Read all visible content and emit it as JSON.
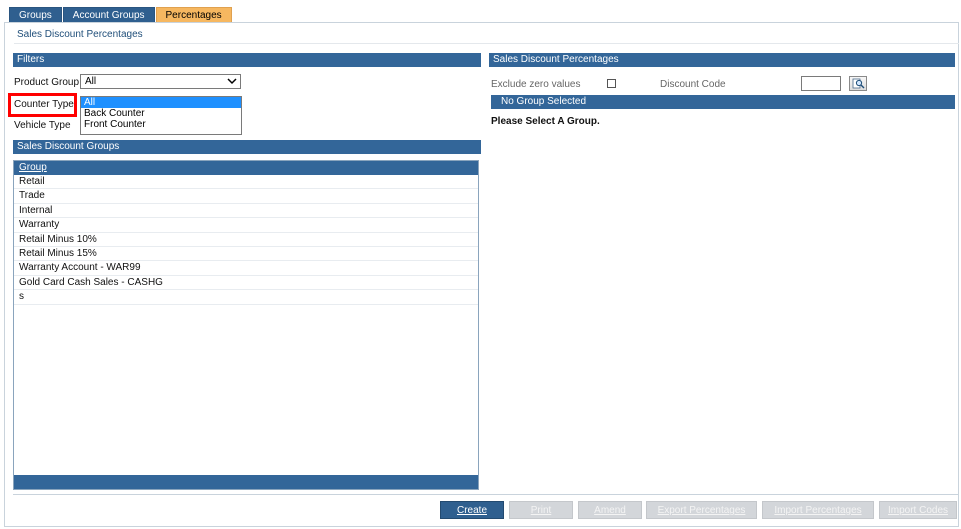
{
  "tabs": [
    {
      "label": "Groups"
    },
    {
      "label": "Account Groups"
    },
    {
      "label": "Percentages",
      "active": true
    }
  ],
  "page_title": "Sales Discount Percentages",
  "filters": {
    "title": "Filters",
    "product_group_label": "Product Group",
    "product_group_value": "All",
    "counter_type_label": "Counter Type",
    "counter_type_options": [
      "All",
      "Back Counter",
      "Front Counter"
    ],
    "counter_type_selected": "All",
    "vehicle_type_label": "Vehicle Type"
  },
  "groups_section": {
    "title": "Sales Discount Groups",
    "column_header": "Group",
    "rows": [
      "Retail",
      "Trade",
      "Internal",
      "Warranty",
      "Retail Minus 10%",
      "Retail Minus 15%",
      "Warranty Account - WAR99",
      "Gold Card Cash Sales - CASHG",
      "s"
    ]
  },
  "percentages_section": {
    "title": "Sales Discount Percentages",
    "exclude_zero_label": "Exclude zero values",
    "exclude_zero_checked": false,
    "discount_code_label": "Discount Code",
    "discount_code_value": "",
    "subheader": "No Group Selected",
    "message": "Please Select A Group."
  },
  "buttons": {
    "create": "Create",
    "print": "Print",
    "amend": "Amend",
    "export": "Export Percentages",
    "import_pct": "Import Percentages",
    "import_codes": "Import Codes"
  },
  "colors": {
    "header_blue": "#336699",
    "tab_blue": "#2f5f8f",
    "active_tab": "#f6b760",
    "highlight_red": "#ff0000",
    "selection_blue": "#1e90ff"
  }
}
